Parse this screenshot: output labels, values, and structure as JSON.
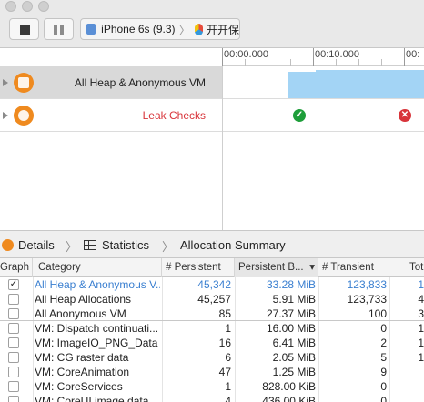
{
  "toolbar": {
    "device": "iPhone 6s (9.3)",
    "separator": "〉",
    "app": "开开保"
  },
  "timeline": {
    "ruler_labels": [
      "00:00.000",
      "00:10.000",
      "00:"
    ],
    "tracks": [
      {
        "name": "All Heap & Anonymous VM",
        "icon": "allocations-icon",
        "selected": true
      },
      {
        "name": "Leak Checks",
        "icon": "leaks-icon",
        "selected": false
      }
    ],
    "leak_marks": [
      {
        "status": "ok",
        "glyph": "✓",
        "color": "#1e9e3a"
      },
      {
        "status": "leak",
        "glyph": "✕",
        "color": "#d8343a"
      }
    ]
  },
  "jumpbar": {
    "details": "Details",
    "statistics": "Statistics",
    "allocation_summary": "Allocation Summary",
    "chevron": "〉"
  },
  "table": {
    "columns": [
      "Graph",
      "Category",
      "# Persistent",
      "Persistent B...",
      "# Transient",
      "Tot"
    ],
    "sort_arrow": "▾",
    "rows": [
      {
        "checked": "✓",
        "category": "All Heap & Anonymous V...",
        "persistent": "45,342",
        "persistent_bytes": "33.28 MiB",
        "transient": "123,833",
        "total": "1"
      },
      {
        "checked": "",
        "category": "All Heap Allocations",
        "persistent": "45,257",
        "persistent_bytes": "5.91 MiB",
        "transient": "123,733",
        "total": "4"
      },
      {
        "checked": "",
        "category": "All Anonymous VM",
        "persistent": "85",
        "persistent_bytes": "27.37 MiB",
        "transient": "100",
        "total": "3"
      },
      {
        "checked": "",
        "category": "VM: Dispatch continuati...",
        "persistent": "1",
        "persistent_bytes": "16.00 MiB",
        "transient": "0",
        "total": "1"
      },
      {
        "checked": "",
        "category": "VM: ImageIO_PNG_Data",
        "persistent": "16",
        "persistent_bytes": "6.41 MiB",
        "transient": "2",
        "total": "1"
      },
      {
        "checked": "",
        "category": "VM: CG raster data",
        "persistent": "6",
        "persistent_bytes": "2.05 MiB",
        "transient": "5",
        "total": "1"
      },
      {
        "checked": "",
        "category": "VM: CoreAnimation",
        "persistent": "47",
        "persistent_bytes": "1.25 MiB",
        "transient": "9",
        "total": ""
      },
      {
        "checked": "",
        "category": "VM: CoreServices",
        "persistent": "1",
        "persistent_bytes": "828.00 KiB",
        "transient": "0",
        "total": ""
      },
      {
        "checked": "",
        "category": "VM: CoreUI image data",
        "persistent": "4",
        "persistent_bytes": "436.00 KiB",
        "transient": "0",
        "total": ""
      }
    ]
  }
}
